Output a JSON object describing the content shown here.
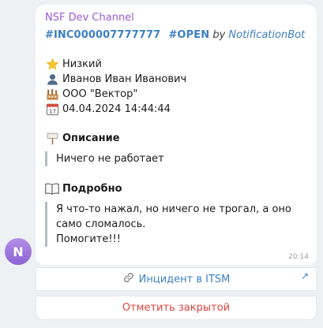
{
  "channel": {
    "name": "NSF Dev Channel"
  },
  "message": {
    "incident_tag": "#INC000007777777",
    "status_tag": "#OPEN",
    "by_text": "by",
    "bot_name": "NotificationBot",
    "priority": "Низкий",
    "person": "Иванов Иван Иванович",
    "company": "ООО \"Вектор\"",
    "datetime": "04.04.2024 14:44:44",
    "description_title": "Описание",
    "description_text": "Ничего не работает",
    "details_title": "Подробно",
    "details_line1": "Я что-то нажал, но ничего не трогал, а оно само сломалось.",
    "details_line2": "Помогите!!!",
    "time": "20:14"
  },
  "avatar": {
    "initial": "N"
  },
  "buttons": {
    "itsm_label": "Инцидент в ITSM",
    "close_label": "Отметить закрытой"
  },
  "icons": {
    "priority": "star-icon",
    "person": "user-icon",
    "company": "factory-icon",
    "datetime": "calendar-icon",
    "description": "signpost-icon",
    "details": "book-icon",
    "itsm": "link-icon",
    "external": "external-arrow-icon"
  },
  "colors": {
    "channel": "#9b59d8",
    "tag": "#3d80c4",
    "link": "#3d80c4",
    "danger": "#e0443c",
    "avatar": "#8b63d4"
  }
}
